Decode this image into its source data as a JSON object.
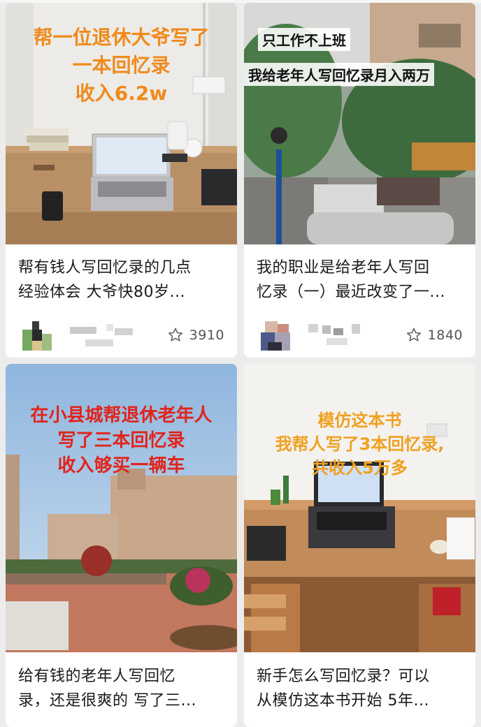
{
  "cards": [
    {
      "overlay_lines": [
        "帮一位退休大爷写了",
        "一本回忆录",
        "收入6.2w"
      ],
      "title_lines": [
        "帮有钱人写回忆录的几点",
        "经验体会 大爷快80岁..."
      ],
      "like_count": "3910",
      "overlay_color": "#f08a1c"
    },
    {
      "overlay_lines": [
        "只工作不上班",
        "我给老年人写回忆录月入两万"
      ],
      "title_lines": [
        "我的职业是给老年人写回",
        "忆录（一）最近改变了一..."
      ],
      "like_count": "1840"
    },
    {
      "overlay_lines": [
        "在小县城帮退休老年人",
        "写了三本回忆录",
        "收入够买一辆车"
      ],
      "title_lines": [
        "给有钱的老年人写回忆",
        "录，还是很爽的 写了三..."
      ],
      "overlay_color": "#e0241c"
    },
    {
      "overlay_lines": [
        "模仿这本书",
        "我帮人写了3本回忆录,",
        "共收入5万多"
      ],
      "title_lines": [
        "新手怎么写回忆录？可以",
        "从模仿这本书开始 5年..."
      ],
      "overlay_color": "#f0a020"
    }
  ],
  "icons": {
    "like": "star-outline-icon",
    "avatar": "blurred-avatar",
    "username": "blurred-username"
  }
}
